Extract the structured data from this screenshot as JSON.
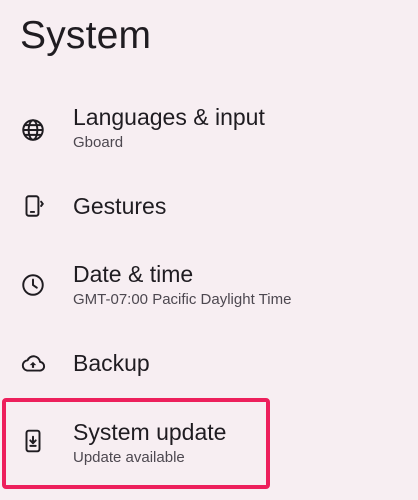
{
  "page": {
    "title": "System"
  },
  "items": [
    {
      "label": "Languages & input",
      "sublabel": "Gboard",
      "icon": "globe-icon"
    },
    {
      "label": "Gestures",
      "sublabel": "",
      "icon": "gestures-icon"
    },
    {
      "label": "Date & time",
      "sublabel": "GMT-07:00 Pacific Daylight Time",
      "icon": "clock-icon"
    },
    {
      "label": "Backup",
      "sublabel": "",
      "icon": "cloud-upload-icon"
    },
    {
      "label": "System update",
      "sublabel": "Update available",
      "icon": "system-update-icon"
    }
  ],
  "colors": {
    "background": "#f7eef2",
    "highlight": "#ed1f5c",
    "text_primary": "#1f1c21",
    "text_secondary": "#4d4850"
  }
}
